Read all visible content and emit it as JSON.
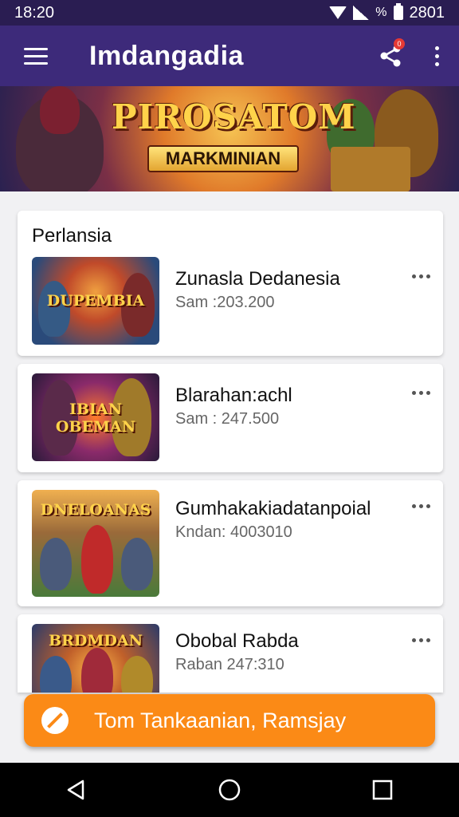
{
  "statusbar": {
    "time": "18:20",
    "battery_pct": "%",
    "right_text": "2801"
  },
  "appbar": {
    "title": "Imdangadia",
    "share_badge": "0"
  },
  "banner": {
    "title": "PIROSATOM",
    "subtitle": "MARKMINIAN"
  },
  "section": {
    "title": "Perlansia"
  },
  "items": [
    {
      "title": "Zunasla Dedanesia",
      "subtitle": "Sam :203.200",
      "thumb_text": "DUPEMBIA"
    },
    {
      "title": "Blarahan:achl",
      "subtitle": "Sam : 247.500",
      "thumb_text": "IBIAN OBEMAN"
    },
    {
      "title": "Gumhakakiadatanpoial",
      "subtitle": "Kndan: 4003010",
      "thumb_text": "DNELOANAS"
    },
    {
      "title": "Obobal Rabda",
      "subtitle": "Raban 247:310",
      "thumb_text": "BRDMDAN"
    }
  ],
  "cta": {
    "label": "Tom Tankaanian, Ramsjay"
  },
  "colors": {
    "appbar": "#3d2a7a",
    "statusbar": "#2a1d52",
    "accent": "#fb8a16"
  },
  "icons": {
    "menu": "hamburger-icon",
    "share": "share-icon",
    "more": "more-vertical-icon",
    "cta": "cancel-circle-icon"
  }
}
